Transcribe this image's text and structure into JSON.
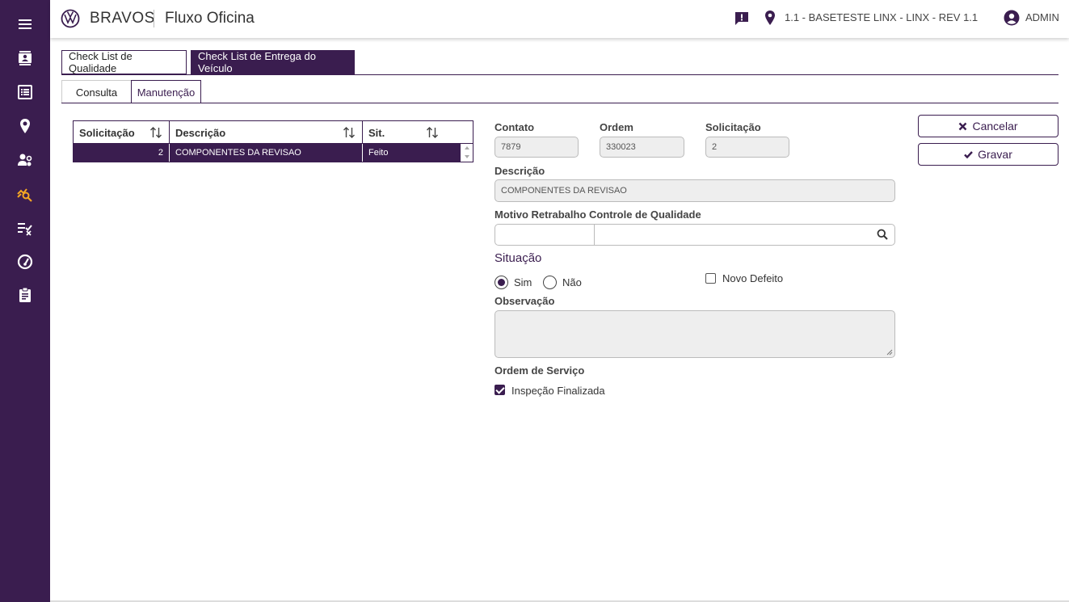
{
  "header": {
    "brand": "BRAVOS",
    "app_title": "Fluxo Oficina",
    "environment": "1.1 - BASETESTE LINX - LINX - REV 1.1",
    "user": "ADMIN"
  },
  "sidebar": {
    "items": [
      {
        "icon": "menu-icon"
      },
      {
        "icon": "contacts-icon"
      },
      {
        "icon": "list-icon"
      },
      {
        "icon": "location-pin-icon"
      },
      {
        "icon": "users-gear-icon"
      },
      {
        "icon": "analytics-search-icon",
        "active": true
      },
      {
        "icon": "checklist-icon"
      },
      {
        "icon": "speedometer-icon"
      },
      {
        "icon": "clipboard-icon"
      }
    ]
  },
  "tabs": {
    "main": [
      "Check List de Qualidade",
      "Check List de Entrega do Veículo"
    ],
    "active_main": "Check List de Entrega do Veículo",
    "sub": [
      "Consulta",
      "Manutenção"
    ],
    "active_sub": "Manutenção"
  },
  "grid": {
    "columns": [
      "Solicitação",
      "Descrição",
      "Sit."
    ],
    "rows": [
      {
        "solicitacao": "2",
        "descricao": "COMPONENTES DA REVISAO",
        "sit": "Feito"
      }
    ]
  },
  "form": {
    "contato_label": "Contato",
    "contato_value": "7879",
    "ordem_label": "Ordem",
    "ordem_value": "330023",
    "solicitacao_label": "Solicitação",
    "solicitacao_value": "2",
    "descricao_label": "Descrição",
    "descricao_value": "COMPONENTES DA REVISAO",
    "motivo_label": "Motivo Retrabalho Controle de Qualidade",
    "motivo_code": "",
    "motivo_desc": "",
    "situacao_title": "Situação",
    "radio_sim": "Sim",
    "radio_nao": "Não",
    "situacao_value": "Sim",
    "novo_defeito_label": "Novo Defeito",
    "novo_defeito_checked": false,
    "observacao_label": "Observação",
    "observacao_value": "",
    "ordem_servico_label": "Ordem de Serviço",
    "inspecao_label": "Inspeção Finalizada",
    "inspecao_checked": true
  },
  "actions": {
    "cancel": "Cancelar",
    "save": "Gravar"
  },
  "colors": {
    "primary": "#3a1d4f",
    "accent": "#f5a623"
  }
}
